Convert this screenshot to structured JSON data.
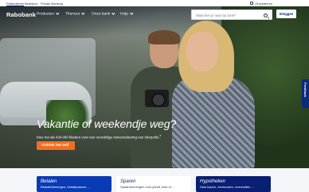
{
  "top_segments": [
    "Particulieren",
    "Bedrijven",
    "Private Banking"
  ],
  "top_right": {
    "label": "Omzetbeurs"
  },
  "header": {
    "logo": "Rabobank",
    "nav": [
      "Producten",
      "Thema's",
      "Onze bank",
      "Hulp"
    ],
    "search_placeholder": "Waar ben je naar op zoek?",
    "login_label": "Inloggen"
  },
  "hero": {
    "title": "Vakantie of weekendje weg?",
    "subtitle": "Kies net als 434.000 klanten voor een voordelige reisverzekering van Interpolis.",
    "superscript": "8",
    "cta": "Ontdek het zelf"
  },
  "feedback_label": "Feedback",
  "cards": [
    {
      "title": "Betalen",
      "subtitle": "Betaalrekeningen, betaalpassen, ..."
    },
    {
      "title": "Sparen",
      "subtitle": "Spaarrekeningen voor jezelf, kind of ..."
    },
    {
      "title": "Hypotheken",
      "subtitle": "Huis kopen, verbouwen, oversluiten ..."
    }
  ],
  "colors": {
    "brand_navy": "#0a2a7a",
    "cta_orange": "#f36e20",
    "card_blue": "#0a3bb4"
  }
}
